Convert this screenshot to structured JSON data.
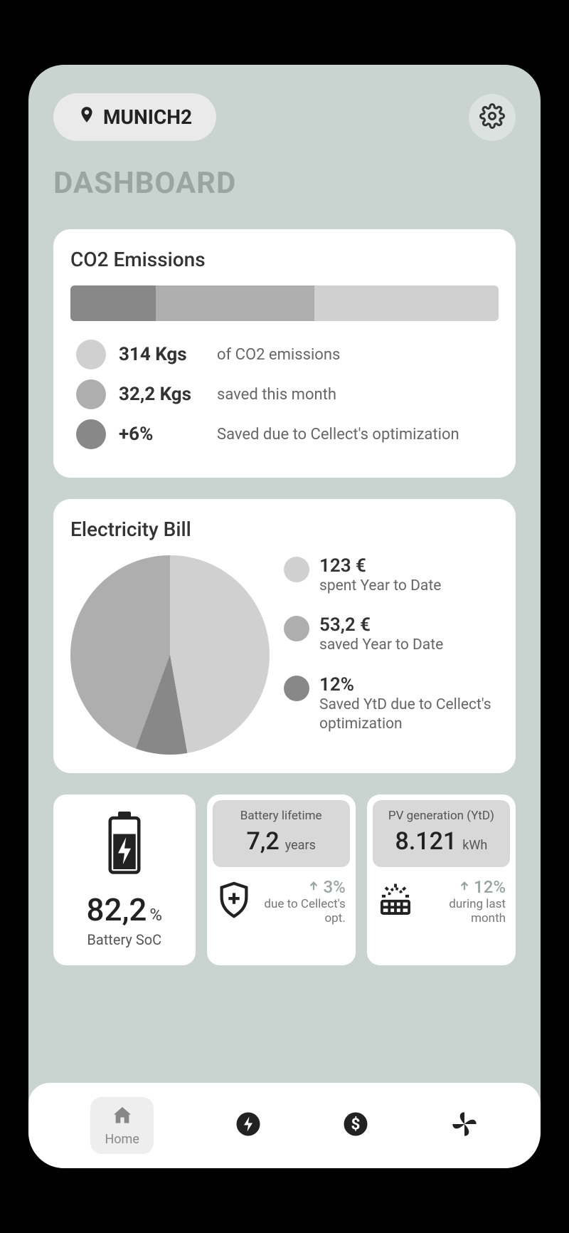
{
  "location": "MUNICH2",
  "page_title": "DASHBOARD",
  "co2": {
    "title": "CO2 Emissions",
    "bar": {
      "dark_pct": 20,
      "mid_pct": 57
    },
    "items": [
      {
        "color": "#d0d0d0",
        "value": "314 Kgs",
        "label": "of CO2 emissions"
      },
      {
        "color": "#aeaeae",
        "value": "32,2 Kgs",
        "label": "saved this month"
      },
      {
        "color": "#888888",
        "value": "+6%",
        "label": "Saved due to Cellect's optimization"
      }
    ]
  },
  "bill": {
    "title": "Electricity Bill",
    "items": [
      {
        "color": "#d0d0d0",
        "value": "123 €",
        "label": "spent Year to Date"
      },
      {
        "color": "#aeaeae",
        "value": "53,2 €",
        "label": "saved Year to Date"
      },
      {
        "color": "#888888",
        "value": "12%",
        "label": "Saved YtD due to Cellect's optimization"
      }
    ]
  },
  "soc": {
    "value": "82,2",
    "unit": "%",
    "label": "Battery SoC"
  },
  "lifetime": {
    "title": "Battery lifetime",
    "value": "7,2",
    "unit": "years",
    "delta": "3%",
    "delta_label": "due to Cellect's opt."
  },
  "pv": {
    "title": "PV generation (YtD)",
    "value": "8.121",
    "unit": "kWh",
    "delta": "12%",
    "delta_label": "during last month"
  },
  "nav": {
    "home": "Home"
  },
  "chart_data": [
    {
      "type": "bar",
      "title": "CO2 Emissions",
      "series": [
        {
          "name": "of CO2 emissions",
          "values": [
            314
          ],
          "unit": "Kgs"
        },
        {
          "name": "saved this month",
          "values": [
            32.2
          ],
          "unit": "Kgs"
        },
        {
          "name": "Saved due to Cellect's optimization",
          "values": [
            6
          ],
          "unit": "%"
        }
      ]
    },
    {
      "type": "pie",
      "title": "Electricity Bill",
      "series": [
        {
          "name": "spent Year to Date",
          "values": [
            123
          ],
          "unit": "€"
        },
        {
          "name": "saved Year to Date",
          "values": [
            53.2
          ],
          "unit": "€"
        },
        {
          "name": "Saved YtD due to Cellect's optimization",
          "values": [
            12
          ],
          "unit": "%"
        }
      ],
      "slices_deg": {
        "light": 170,
        "mid": 160,
        "dark": 30
      }
    }
  ]
}
